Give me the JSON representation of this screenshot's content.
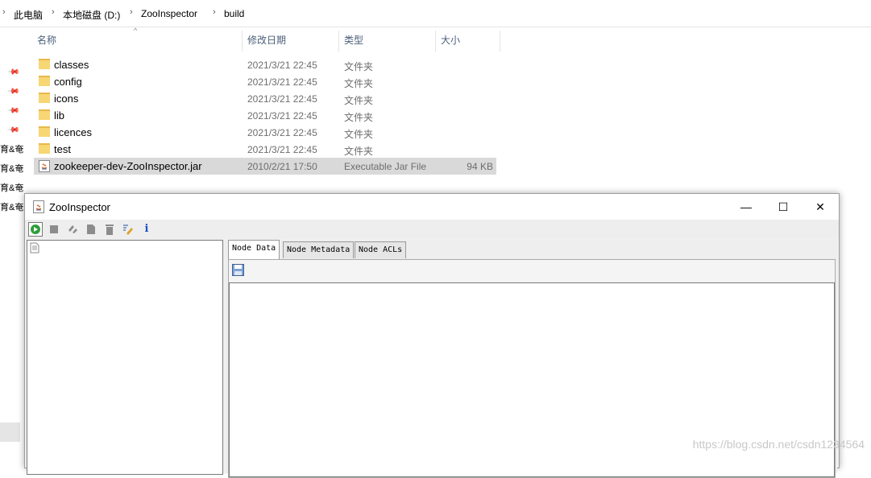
{
  "explorer": {
    "breadcrumbs": [
      "此电脑",
      "本地磁盘 (D:)",
      "ZooInspector",
      "build"
    ],
    "columns": [
      "名称",
      "修改日期",
      "类型",
      "大小"
    ],
    "nav_labels": [
      "育&奄",
      "育&奄",
      "育&奄",
      "育&奄"
    ],
    "files": [
      {
        "name": "classes",
        "date": "2021/3/21 22:45",
        "type": "文件夹",
        "size": "",
        "icon": "folder-icon"
      },
      {
        "name": "config",
        "date": "2021/3/21 22:45",
        "type": "文件夹",
        "size": "",
        "icon": "folder-icon"
      },
      {
        "name": "icons",
        "date": "2021/3/21 22:45",
        "type": "文件夹",
        "size": "",
        "icon": "folder-icon"
      },
      {
        "name": "lib",
        "date": "2021/3/21 22:45",
        "type": "文件夹",
        "size": "",
        "icon": "folder-icon"
      },
      {
        "name": "licences",
        "date": "2021/3/21 22:45",
        "type": "文件夹",
        "size": "",
        "icon": "folder-icon"
      },
      {
        "name": "test",
        "date": "2021/3/21 22:45",
        "type": "文件夹",
        "size": "",
        "icon": "folder-icon"
      },
      {
        "name": "zookeeper-dev-ZooInspector.jar",
        "date": "2010/2/21 17:50",
        "type": "Executable Jar File",
        "size": "94 KB",
        "icon": "jar-icon"
      }
    ]
  },
  "app": {
    "title": "ZooInspector",
    "window_buttons": {
      "minimize": "—",
      "maximize": "☐",
      "close": "✕"
    },
    "toolbar_icons": [
      "connect-icon",
      "disconnect-icon",
      "refresh-icon",
      "add-node-icon",
      "delete-node-icon",
      "edit-icon",
      "info-icon"
    ],
    "info_glyph": "i",
    "tabs": [
      "Node Data",
      "Node Metadata",
      "Node ACLs"
    ],
    "active_tab": "Node Data"
  },
  "watermark": "https://blog.csdn.net/csdn1234564"
}
